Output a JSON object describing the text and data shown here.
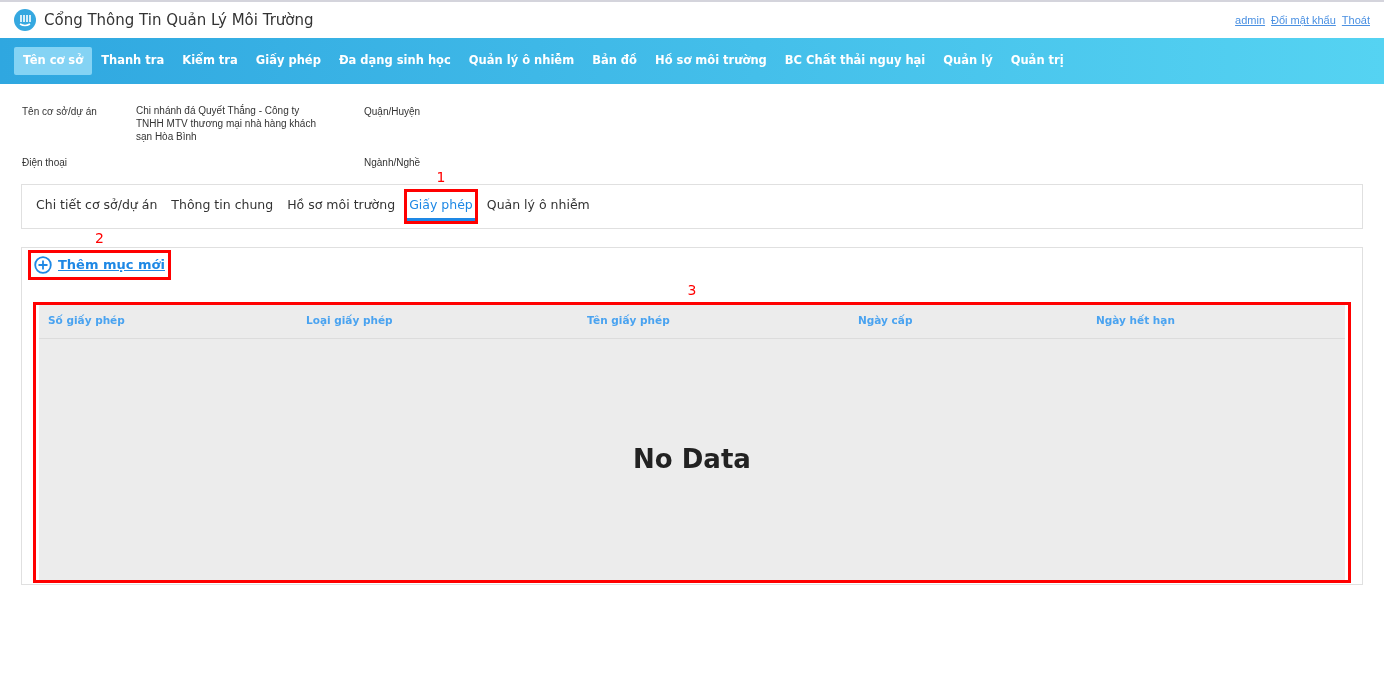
{
  "header": {
    "title": "Cổng Thông Tin Quản Lý Môi Trường",
    "links": [
      "admin",
      "Đổi mật khẩu",
      "Thoát"
    ]
  },
  "nav": [
    {
      "label": "Tên cơ sở",
      "selected": true
    },
    {
      "label": "Thanh tra",
      "selected": false
    },
    {
      "label": "Kiểm tra",
      "selected": false
    },
    {
      "label": "Giấy phép",
      "selected": false
    },
    {
      "label": "Đa dạng sinh học",
      "selected": false
    },
    {
      "label": "Quản lý ô nhiễm",
      "selected": false
    },
    {
      "label": "Bản đồ",
      "selected": false
    },
    {
      "label": "Hồ sơ môi trường",
      "selected": false
    },
    {
      "label": "BC Chất thải nguy hại",
      "selected": false
    },
    {
      "label": "Quản lý",
      "selected": false
    },
    {
      "label": "Quản trị",
      "selected": false
    }
  ],
  "info": {
    "left": [
      {
        "label": "Tên cơ sở/dự án",
        "value": "Chi nhánh đá Quyết Thắng - Công ty TNHH MTV thương mại nhà hàng khách sạn Hòa Bình"
      },
      {
        "label": "Điện thoại"
      }
    ],
    "right": [
      "Quận/Huyện",
      "Ngành/Nghề"
    ]
  },
  "tabs": [
    {
      "label": "Chi tiết cơ sở/dự án",
      "selected": false
    },
    {
      "label": "Thông tin chung",
      "selected": false
    },
    {
      "label": "Hồ sơ môi trường",
      "selected": false
    },
    {
      "label": "Giấy phép",
      "selected": true,
      "annotation": "1"
    },
    {
      "label": "Quản lý ô nhiễm",
      "selected": false
    }
  ],
  "add_button": {
    "label": "Thêm mục mới",
    "annotation": "2"
  },
  "table": {
    "annotation": "3",
    "columns": [
      "Số giấy phép",
      "Loại giấy phép",
      "Tên giấy phép",
      "Ngày cấp",
      "Ngày hết hạn"
    ],
    "empty_text": "No Data"
  }
}
